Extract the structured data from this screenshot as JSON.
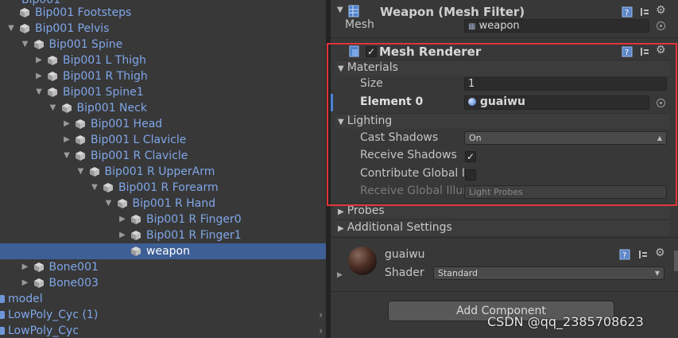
{
  "hierarchy": {
    "top_partial": "Bip001",
    "items": [
      {
        "label": "Bip001 Footsteps",
        "depth": 1,
        "fold": "",
        "selected": false
      },
      {
        "label": "Bip001 Pelvis",
        "depth": 1,
        "fold": "open",
        "selected": false
      },
      {
        "label": "Bip001 Spine",
        "depth": 2,
        "fold": "open",
        "selected": false
      },
      {
        "label": "Bip001 L Thigh",
        "depth": 3,
        "fold": "closed",
        "selected": false
      },
      {
        "label": "Bip001 R Thigh",
        "depth": 3,
        "fold": "closed",
        "selected": false
      },
      {
        "label": "Bip001 Spine1",
        "depth": 3,
        "fold": "open",
        "selected": false
      },
      {
        "label": "Bip001 Neck",
        "depth": 4,
        "fold": "open",
        "selected": false
      },
      {
        "label": "Bip001 Head",
        "depth": 5,
        "fold": "closed",
        "selected": false
      },
      {
        "label": "Bip001 L Clavicle",
        "depth": 5,
        "fold": "closed",
        "selected": false
      },
      {
        "label": "Bip001 R Clavicle",
        "depth": 5,
        "fold": "open",
        "selected": false
      },
      {
        "label": "Bip001 R UpperArm",
        "depth": 6,
        "fold": "open",
        "selected": false
      },
      {
        "label": "Bip001 R Forearm",
        "depth": 7,
        "fold": "open",
        "selected": false
      },
      {
        "label": "Bip001 R Hand",
        "depth": 8,
        "fold": "open",
        "selected": false
      },
      {
        "label": "Bip001 R Finger0",
        "depth": 9,
        "fold": "closed",
        "selected": false
      },
      {
        "label": "Bip001 R Finger1",
        "depth": 9,
        "fold": "closed",
        "selected": false
      },
      {
        "label": "weapon",
        "depth": 9,
        "fold": "",
        "selected": true
      },
      {
        "label": "Bone001",
        "depth": 2,
        "fold": "closed",
        "selected": false
      },
      {
        "label": "Bone003",
        "depth": 2,
        "fold": "closed",
        "selected": false
      }
    ],
    "roots": [
      {
        "label": "model",
        "chevron": false
      },
      {
        "label": "LowPoly_Cyc (1)",
        "chevron": true
      },
      {
        "label": "LowPoly_Cyc",
        "chevron": true
      }
    ]
  },
  "inspector": {
    "mesh_filter": {
      "title": "Weapon (Mesh Filter)",
      "mesh_label": "Mesh",
      "mesh_value": "weapon"
    },
    "mesh_renderer": {
      "title": "Mesh Renderer",
      "enabled": true,
      "materials": {
        "header": "Materials",
        "size_label": "Size",
        "size_value": "1",
        "element_label": "Element 0",
        "element_value": "guaiwu"
      },
      "lighting": {
        "header": "Lighting",
        "cast_shadows_label": "Cast Shadows",
        "cast_shadows_value": "On",
        "receive_shadows_label": "Receive Shadows",
        "receive_shadows_checked": true,
        "contribute_gi_label": "Contribute Global I",
        "contribute_gi_checked": false,
        "receive_gi_label": "Receive Global Illur",
        "receive_gi_value": "Light Probes"
      }
    },
    "probes_header": "Probes",
    "additional_settings_header": "Additional Settings",
    "material": {
      "name": "guaiwu",
      "shader_label": "Shader",
      "shader_value": "Standard"
    },
    "add_component_label": "Add Component"
  },
  "watermark": "CSDN @qq_2385708623",
  "colors": {
    "highlight_border": "#e0353a",
    "selection": "#3e5f96",
    "hierarchy_text": "#7fa6e8"
  }
}
